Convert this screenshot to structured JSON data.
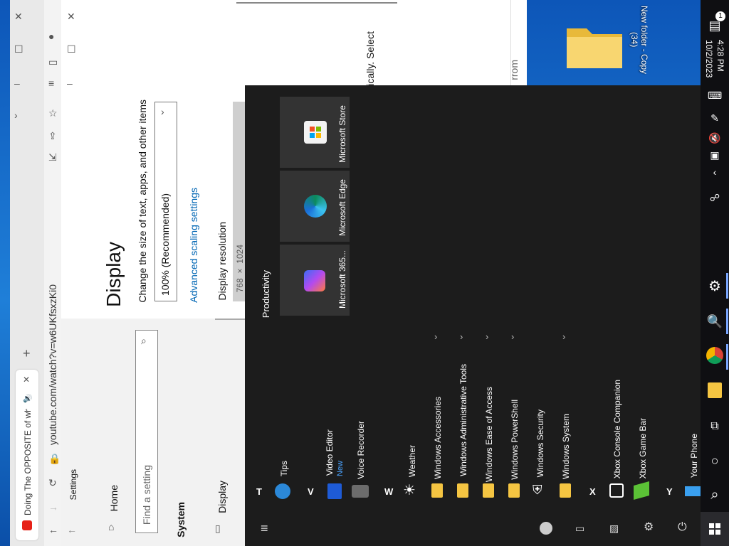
{
  "desktop": {
    "folder_label_line1": "New folder - Copy",
    "folder_label_line2": "(34)"
  },
  "browser": {
    "tab_title": "Doing The OPPOSITE of wh",
    "url": "youtube.com/watch?v=w6UKfsxzKi0",
    "new_tab": "+"
  },
  "settings": {
    "app_title": "Settings",
    "nav_home": "Home",
    "search_placeholder": "Find a setting",
    "section_system": "System",
    "nav_display": "Display",
    "page_title": "Display",
    "scale_heading": "Change the size of text, apps, and other items",
    "scale_value": "100% (Recommended)",
    "advanced_link": "Advanced scaling settings",
    "resolution_heading": "Display resolution",
    "resolution_value": "768 × 1024",
    "behind_text": "tically. Select",
    "behind_text2": "rrom"
  },
  "start_menu": {
    "group_title": "Productivity",
    "tiles": [
      {
        "label": "Microsoft 365...",
        "icon": "office-icon"
      },
      {
        "label": "Microsoft Edge",
        "icon": "edge-icon"
      },
      {
        "label": "Microsoft Store",
        "icon": "store-icon"
      }
    ],
    "letters": {
      "t": "T",
      "v": "V",
      "w": "W",
      "x": "X",
      "y": "Y"
    },
    "apps": {
      "tips": "Tips",
      "video_editor": "Video Editor",
      "video_editor_badge": "New",
      "voice_recorder": "Voice Recorder",
      "weather": "Weather",
      "win_accessories": "Windows Accessories",
      "win_admin_tools": "Windows Administrative Tools",
      "win_ease": "Windows Ease of Access",
      "win_powershell": "Windows PowerShell",
      "win_security": "Windows Security",
      "win_system": "Windows System",
      "xbox_companion": "Xbox Console Companion",
      "xbox_game_bar": "Xbox Game Bar",
      "your_phone": "Your Phone"
    }
  },
  "taskbar": {
    "time": "4:28 PM",
    "date": "10/2/2023",
    "notification_count": "1"
  },
  "colors": {
    "start_bg": "#1c1c1c",
    "taskbar_bg": "#0f0f12",
    "accent": "#0066b4",
    "folder": "#f5c542"
  }
}
